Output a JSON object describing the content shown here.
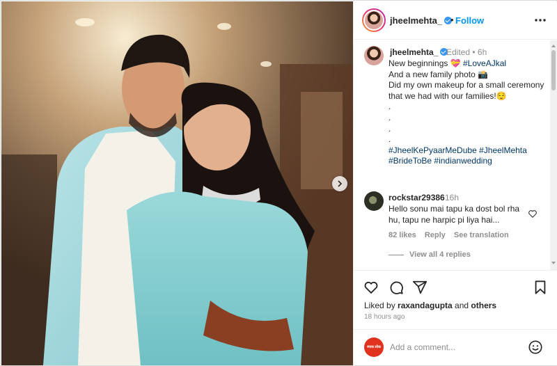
{
  "post": {
    "author": "jheelmehta_",
    "follow_label": "Follow",
    "header_separator": "•",
    "more_icon": "more-horizontal-icon",
    "verified_icon": "verified-badge-icon"
  },
  "photo": {
    "description_icon": "couple-photo",
    "next_icon": "chevron-right-icon"
  },
  "caption": {
    "username": "jheelmehta_",
    "edited": "Edited • 6h",
    "line1_text": "New beginnings 💝 ",
    "line1_hashtag": "#LoveAJkal",
    "line2": "And a new family photo 📸",
    "line3": "Did my own makeup for a small ceremony that we had with our families!😌",
    "dots": ".\n.\n.\n.",
    "hashtags_line1a": "#JheelKePyaarMeDube",
    "hashtags_line1b": "#JheelMehta",
    "hashtags_line2a": "#BrideToBe",
    "hashtags_line2b": "#indianwedding"
  },
  "comment": {
    "username": "rockstar29386",
    "time": "16h",
    "text": "Hello sonu mai tapu ka dost bol rha hu, tapu ne harpic pi liya hai...",
    "likes": "82 likes",
    "reply": "Reply",
    "see_translation": "See translation",
    "view_replies": "View all 4 replies",
    "heart_icon": "heart-outline-icon"
  },
  "actions": {
    "like_icon": "heart-icon",
    "comment_icon": "comment-icon",
    "share_icon": "share-icon",
    "save_icon": "bookmark-icon",
    "liked_by_prefix": "Liked by ",
    "liked_by_user": "raxandagupta",
    "liked_by_and": " and ",
    "liked_by_others": "others",
    "time_ago": "18 hours ago"
  },
  "add_comment": {
    "placeholder": "Add a comment...",
    "avatar_text": "स्पाक लोक",
    "emoji_icon": "emoji-smile-icon"
  },
  "colors": {
    "accent": "#0095f6",
    "hashtag": "#00376b",
    "muted": "#8e8e8e",
    "text": "#262626"
  }
}
